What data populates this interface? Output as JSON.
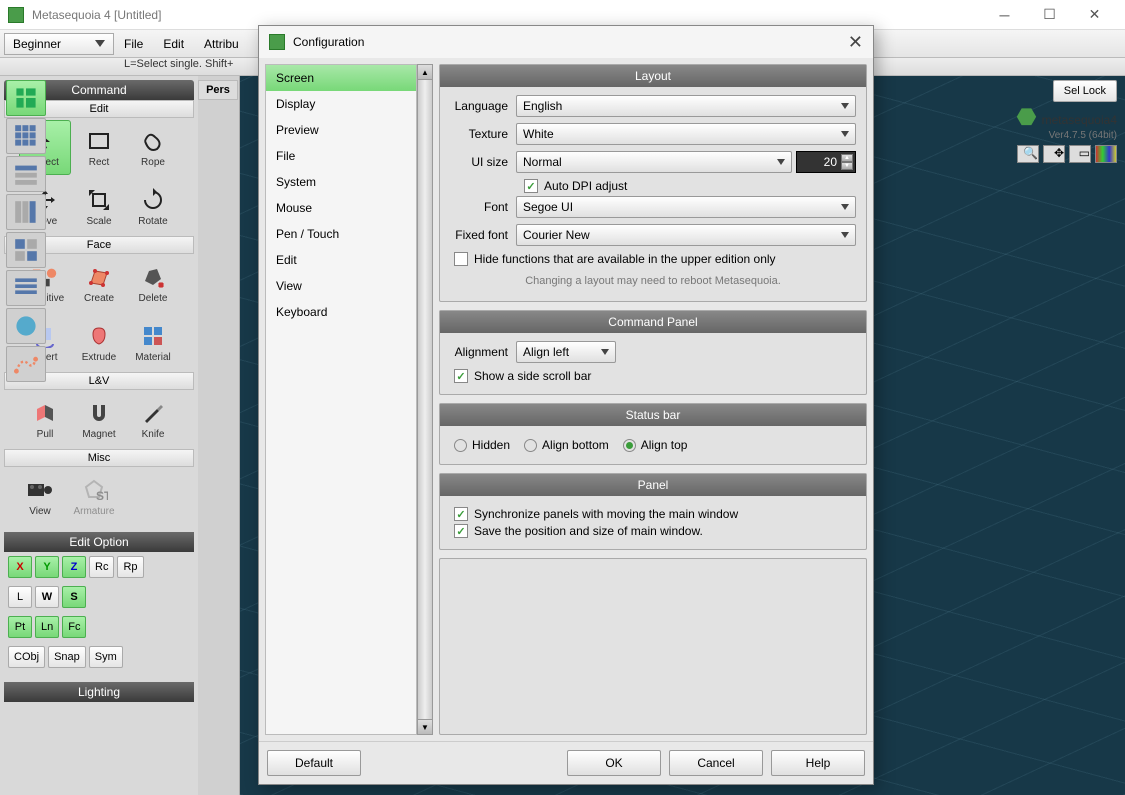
{
  "window": {
    "title": "Metasequoia 4 [Untitled]"
  },
  "menu": [
    "File",
    "Edit",
    "Attribu"
  ],
  "mode": "Beginner",
  "hint": "L=Select single. Shift+",
  "brand": {
    "name": "metasequoia4",
    "version": "Ver4.7.5 (64bit)"
  },
  "vp_buttons": [
    "Sel Lock"
  ],
  "tab": "Pers",
  "command": {
    "title": "Command",
    "groups": [
      {
        "name": "Edit",
        "tools": [
          "Select",
          "Rect",
          "Rope",
          "Move",
          "Scale",
          "Rotate"
        ]
      },
      {
        "name": "Face",
        "tools": [
          "Primitive",
          "Create",
          "Delete",
          "Invert",
          "Extrude",
          "Material"
        ]
      },
      {
        "name": "L&V",
        "tools": [
          "Pull",
          "Magnet",
          "Knife"
        ]
      },
      {
        "name": "Misc",
        "tools": [
          "View",
          "Armature"
        ]
      }
    ]
  },
  "edit_option": {
    "title": "Edit Option",
    "axes": [
      "X",
      "Y",
      "Z"
    ],
    "rc": "Rc",
    "rp": "Rp",
    "l": "L",
    "w": "W",
    "s": "S",
    "pt": "Pt",
    "ln": "Ln",
    "fc": "Fc",
    "cobj": "CObj",
    "snap": "Snap",
    "sym": "Sym"
  },
  "lighting_title": "Lighting",
  "dialog": {
    "title": "Configuration",
    "categories": [
      "Screen",
      "Display",
      "Preview",
      "File",
      "System",
      "Mouse",
      "Pen / Touch",
      "Edit",
      "View",
      "Keyboard"
    ],
    "layout": {
      "title": "Layout",
      "language_label": "Language",
      "language": "English",
      "texture_label": "Texture",
      "texture": "White",
      "uisize_label": "UI size",
      "uisize": "Normal",
      "uisize_num": "20",
      "autodpi": "Auto DPI adjust",
      "font_label": "Font",
      "font": "Segoe UI",
      "fixedfont_label": "Fixed font",
      "fixedfont": "Courier New",
      "hide_upper": "Hide functions that are available in the upper edition only",
      "reboot_hint": "Changing a layout may need to reboot Metasequoia."
    },
    "cmdpanel": {
      "title": "Command Panel",
      "align_label": "Alignment",
      "align": "Align left",
      "scroll": "Show a side scroll bar"
    },
    "statusbar": {
      "title": "Status bar",
      "hidden": "Hidden",
      "bottom": "Align bottom",
      "top": "Align top"
    },
    "panel": {
      "title": "Panel",
      "sync": "Synchronize panels with moving the main window",
      "savepos": "Save the position and size of main window."
    },
    "buttons": {
      "default": "Default",
      "ok": "OK",
      "cancel": "Cancel",
      "help": "Help"
    }
  }
}
